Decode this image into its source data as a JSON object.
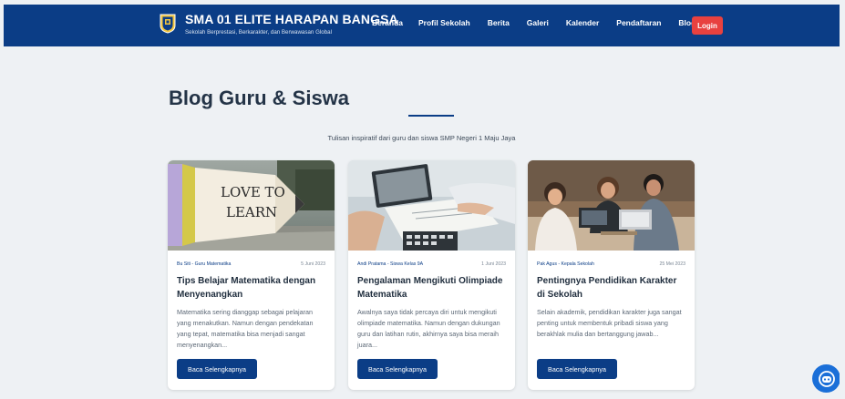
{
  "brand": {
    "title": "SMA 01 ELITE HARAPAN BANGSA",
    "tagline": "Sekolah Berprestasi, Berkarakter, dan Berwawasan Global"
  },
  "nav": {
    "items": [
      "Beranda",
      "Profil Sekolah",
      "Berita",
      "Galeri",
      "Kalender",
      "Pendaftaran",
      "Blog"
    ],
    "login": "Login"
  },
  "hero": {
    "title": "Blog Guru & Siswa",
    "subtitle": "Tulisan inspiratif dari guru dan siswa SMP Negeri 1 Maju Jaya"
  },
  "cards": [
    {
      "image_label_1": "LOVE TO",
      "image_label_2": "LEARN",
      "author": "Bu Siti - Guru Matematika",
      "date": "5 Juni 2023",
      "title": "Tips Belajar Matematika dengan Menyenangkan",
      "excerpt": "Matematika sering dianggap sebagai pelajaran yang menakutkan. Namun dengan pendekatan yang tepat, matematika bisa menjadi sangat menyenangkan...",
      "button": "Baca Selengkapnya"
    },
    {
      "author": "Andi Pratama - Siswa Kelas 9A",
      "date": "1 Juni 2023",
      "title": "Pengalaman Mengikuti Olimpiade Matematika",
      "excerpt": "Awalnya saya tidak percaya diri untuk mengikuti olimpiade matematika. Namun dengan dukungan guru dan latihan rutin, akhirnya saya bisa meraih juara...",
      "button": "Baca Selengkapnya"
    },
    {
      "author": "Pak Agus - Kepala Sekolah",
      "date": "25 Mei 2023",
      "title": "Pentingnya Pendidikan Karakter di Sekolah",
      "excerpt": "Selain akademik, pendidikan karakter juga sangat penting untuk membentuk pribadi siswa yang berakhlak mulia dan bertanggung jawab...",
      "button": "Baca Selengkapnya"
    }
  ],
  "colors": {
    "navbar": "#0b3d86",
    "login": "#e8413f",
    "background": "#eef1f4",
    "chat": "#1a6fd8"
  },
  "icons": {
    "logo": "school-crest-icon",
    "chat": "chatbot-icon"
  }
}
